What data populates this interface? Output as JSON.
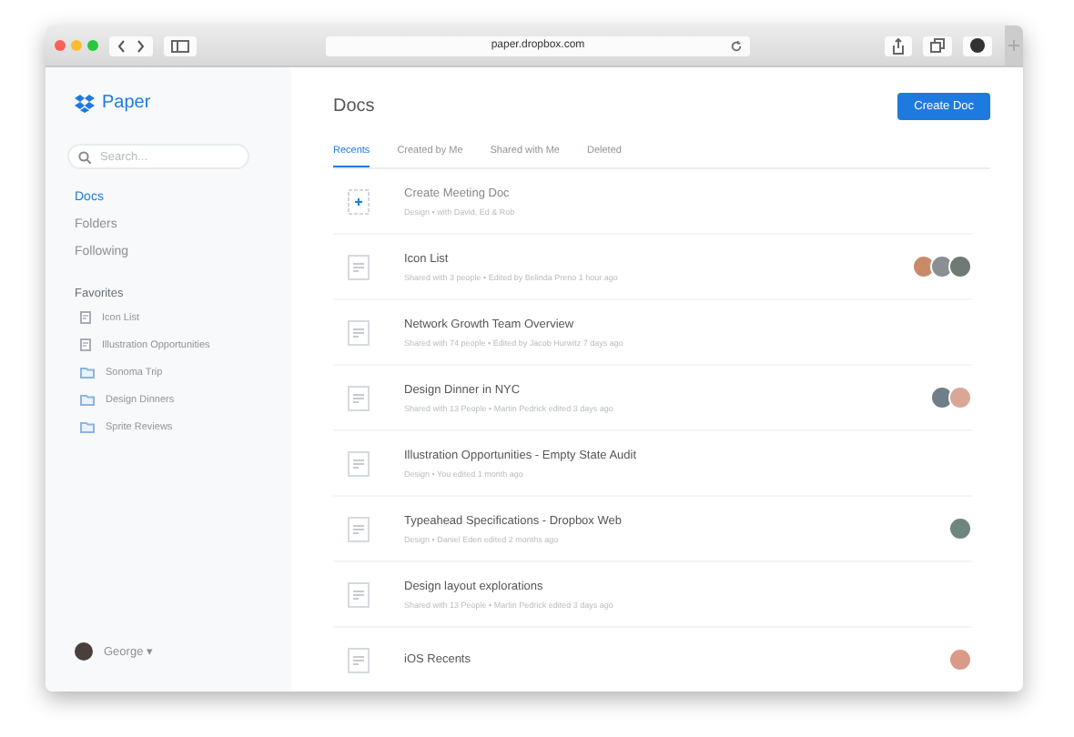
{
  "browser": {
    "url": "paper.dropbox.com"
  },
  "sidebar": {
    "brand": "Paper",
    "search": {
      "placeholder": "Search..."
    },
    "nav": [
      {
        "label": "Docs",
        "selected": true
      },
      {
        "label": "Folders",
        "selected": false
      },
      {
        "label": "Following",
        "selected": false
      }
    ],
    "favorites_title": "Favorites",
    "favorites": [
      {
        "kind": "doc",
        "label": "Icon List"
      },
      {
        "kind": "doc",
        "label": "Illustration Opportunities"
      },
      {
        "kind": "folder",
        "label": "Sonoma Trip"
      },
      {
        "kind": "folder",
        "label": "Design Dinners"
      },
      {
        "kind": "folder",
        "label": "Sprite Reviews"
      }
    ],
    "user": {
      "name": "George",
      "caret": "▾"
    }
  },
  "main": {
    "title": "Docs",
    "create_button": "Create Doc",
    "tabs": [
      {
        "label": "Recents",
        "selected": true
      },
      {
        "label": "Created by Me",
        "selected": false
      },
      {
        "label": "Shared with Me",
        "selected": false
      },
      {
        "label": "Deleted",
        "selected": false
      }
    ],
    "docs": [
      {
        "kind": "new",
        "title": "Create Meeting Doc",
        "meta": "Design • with David, Ed & Rob"
      },
      {
        "kind": "doc",
        "title": "Icon List",
        "meta": "Shared with 3 people • Edited by Belinda Preno 1 hour ago",
        "avatars": [
          {
            "color": "#c98a6a"
          },
          {
            "color": "#8a8f94"
          },
          {
            "color": "#6f7a74"
          }
        ]
      },
      {
        "kind": "doc",
        "title": "Network Growth Team Overview",
        "meta": "Shared with 74 people • Edited by Jacob Hurwitz 7 days ago"
      },
      {
        "kind": "doc",
        "title": "Design Dinner in NYC",
        "meta": "Shared with 13 People • Martin Pedrick edited 3 days ago",
        "avatars": [
          {
            "color": "#6f7e88"
          },
          {
            "color": "#d9a796"
          }
        ]
      },
      {
        "kind": "doc",
        "title": "Illustration Opportunities - Empty State Audit",
        "meta": "Design • You edited 1 month ago"
      },
      {
        "kind": "doc",
        "title": "Typeahead Specifications - Dropbox Web",
        "meta": "Design • Daniel Eden edited 2 months ago",
        "avatars": [
          {
            "color": "#6e8580"
          }
        ]
      },
      {
        "kind": "doc",
        "title": "Design layout explorations",
        "meta": "Shared with 13 People • Martin Pedrick edited 3 days ago"
      },
      {
        "kind": "doc",
        "title": "iOS Recents",
        "avatars": [
          {
            "color": "#d99a88"
          }
        ]
      }
    ]
  }
}
